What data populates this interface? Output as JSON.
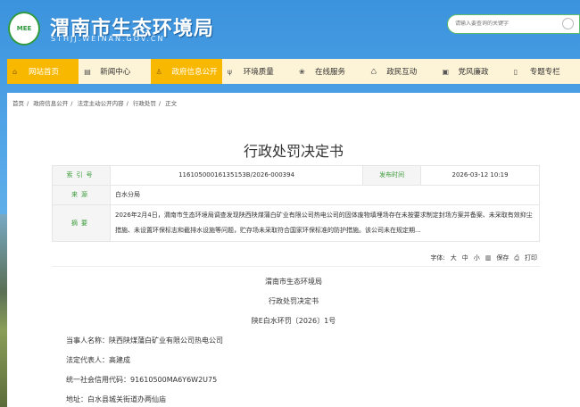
{
  "header": {
    "site_title": "渭南市生态环境局",
    "site_url": "STHJJ.WEINAN.GOV.CN",
    "logo_text": "MEE",
    "search_placeholder": "请输入要查询的关键字"
  },
  "nav": [
    {
      "label": "网站首页",
      "icon": "home-icon",
      "active": true
    },
    {
      "label": "新闻中心",
      "icon": "news-icon"
    },
    {
      "label": "政府信息公开",
      "icon": "badge-icon",
      "active": true
    },
    {
      "label": "环境质量",
      "icon": "plant-icon"
    },
    {
      "label": "在线服务",
      "icon": "service-icon"
    },
    {
      "label": "政民互动",
      "icon": "chat-icon"
    },
    {
      "label": "党风廉政",
      "icon": "inbox-icon"
    },
    {
      "label": "专题专栏",
      "icon": "phone-icon"
    }
  ],
  "breadcrumb": [
    "首页",
    "政府信息公开",
    "法定主动公开内容",
    "行政处罚",
    "正文"
  ],
  "title": "行政处罚决定书",
  "meta": {
    "index_label": "索引号",
    "index_value": "11610500016135153B/2026-000394",
    "date_label": "发布时间",
    "date_value": "2026-03-12 10:19",
    "source_label": "来源",
    "source_value": "白水分局",
    "summary_label": "摘要",
    "summary_value": "2026年2月4日，渭南市生态环境局调查发现陕西陕煤蒲白矿业有限公司热电公司的固体废物填埋场存在未按要求制定封场方案并备案、未采取有效抑尘措施、未设置环保标志和截排水设施等问题，贮存场未采取符合国家环保标准的防护措施。该公司未在规定期..."
  },
  "tools": {
    "font_label": "字体:",
    "large": "大",
    "medium": "中",
    "small": "小",
    "save": "保存",
    "print": "打印"
  },
  "body": {
    "org": "渭南市生态环境局",
    "doc_type": "行政处罚决定书",
    "doc_no": "陕E白水环罚〔2026〕1号",
    "party": "当事人名称：陕西陕煤蒲白矿业有限公司热电公司",
    "rep": "法定代表人：高建成",
    "credit": "统一社会信用代码：91610500MA6Y6W2U75",
    "address": "地址：白水县城关街道办两仙庙"
  }
}
